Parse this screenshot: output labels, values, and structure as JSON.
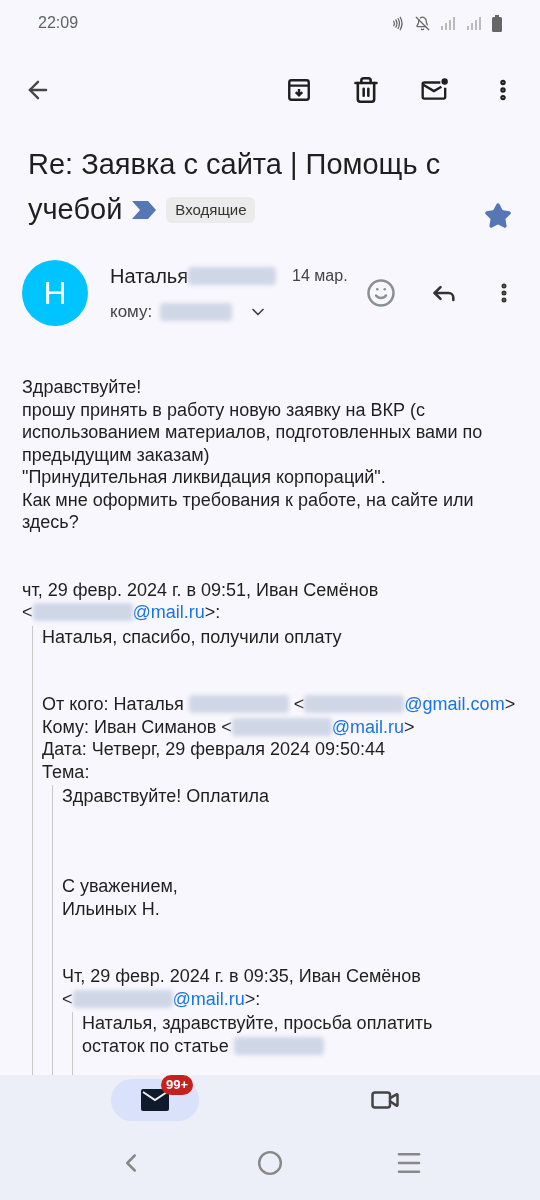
{
  "status_bar": {
    "time": "22:09"
  },
  "subject": {
    "lines": [
      "Re: Заявка с сайта | Помощь с",
      "учебой"
    ],
    "important": true,
    "label": "Входящие",
    "starred": true
  },
  "sender": {
    "avatar_letter": "Н",
    "name": [
      {
        "kind": "text",
        "text": "Наталья"
      },
      {
        "kind": "redacted"
      }
    ],
    "date": "14 мар.",
    "to_label": "кому:"
  },
  "body": [
    {
      "kind": "line",
      "segments": [
        {
          "kind": "text",
          "text": "Здравствуйте!"
        }
      ]
    },
    {
      "kind": "line",
      "segments": [
        {
          "kind": "text",
          "text": "прошу принять в работу новую заявку на ВКР (с"
        }
      ]
    },
    {
      "kind": "line",
      "segments": [
        {
          "kind": "text",
          "text": "использованием материалов, подготовленных вами по"
        }
      ]
    },
    {
      "kind": "line",
      "segments": [
        {
          "kind": "text",
          "text": "предыдущим заказам)"
        }
      ]
    },
    {
      "kind": "line",
      "segments": [
        {
          "kind": "text",
          "text": "\"Принудительная ликвидация корпораций\"."
        }
      ]
    },
    {
      "kind": "line",
      "segments": [
        {
          "kind": "text",
          "text": "Как мне оформить требования к работе, на сайте или"
        }
      ]
    },
    {
      "kind": "line",
      "segments": [
        {
          "kind": "text",
          "text": "здесь?"
        }
      ]
    },
    {
      "kind": "blank"
    },
    {
      "kind": "blank"
    },
    {
      "kind": "line",
      "segments": [
        {
          "kind": "text",
          "text": "чт, 29 февр. 2024 г. в 09:51, Иван Семёнов"
        }
      ]
    },
    {
      "kind": "line",
      "segments": [
        {
          "kind": "text",
          "text": "<"
        },
        {
          "kind": "redacted"
        },
        {
          "kind": "link",
          "text": "@mail.ru"
        },
        {
          "kind": "text",
          "text": ">:"
        }
      ]
    },
    {
      "kind": "quote",
      "children": [
        {
          "kind": "line",
          "segments": [
            {
              "kind": "text",
              "text": "Наталья, спасибо, получили оплату"
            }
          ]
        },
        {
          "kind": "blank"
        },
        {
          "kind": "blank"
        },
        {
          "kind": "line",
          "segments": [
            {
              "kind": "text",
              "text": "От кого: Наталья "
            },
            {
              "kind": "redacted"
            },
            {
              "kind": "text",
              "text": " <"
            },
            {
              "kind": "redacted"
            },
            {
              "kind": "link",
              "text": "@gmail.com"
            },
            {
              "kind": "text",
              "text": ">"
            }
          ]
        },
        {
          "kind": "line",
          "segments": [
            {
              "kind": "text",
              "text": "Кому: Иван Симанов <"
            },
            {
              "kind": "redacted"
            },
            {
              "kind": "link",
              "text": "@mail.ru"
            },
            {
              "kind": "text",
              "text": ">"
            }
          ]
        },
        {
          "kind": "line",
          "segments": [
            {
              "kind": "text",
              "text": "Дата: Четверг, 29 февраля 2024 09:50:44"
            }
          ]
        },
        {
          "kind": "line",
          "segments": [
            {
              "kind": "text",
              "text": "Тема:"
            }
          ]
        },
        {
          "kind": "quote",
          "children": [
            {
              "kind": "line",
              "segments": [
                {
                  "kind": "text",
                  "text": "Здравствуйте! Оплатила"
                }
              ]
            },
            {
              "kind": "blank"
            },
            {
              "kind": "blank"
            },
            {
              "kind": "blank"
            },
            {
              "kind": "line",
              "segments": [
                {
                  "kind": "text",
                  "text": "С уважением,"
                }
              ]
            },
            {
              "kind": "line",
              "segments": [
                {
                  "kind": "text",
                  "text": "Ильиных Н."
                }
              ]
            },
            {
              "kind": "blank"
            },
            {
              "kind": "blank"
            },
            {
              "kind": "line",
              "segments": [
                {
                  "kind": "text",
                  "text": "Чт, 29 февр. 2024 г. в 09:35, Иван Семёнов"
                }
              ]
            },
            {
              "kind": "line",
              "segments": [
                {
                  "kind": "text",
                  "text": "<"
                },
                {
                  "kind": "redacted"
                },
                {
                  "kind": "link",
                  "text": "@mail.ru"
                },
                {
                  "kind": "text",
                  "text": ">:"
                }
              ]
            },
            {
              "kind": "quote",
              "children": [
                {
                  "kind": "line",
                  "segments": [
                    {
                      "kind": "text",
                      "text": "Наталья, здравствуйте, просьба оплатить"
                    }
                  ]
                },
                {
                  "kind": "line",
                  "segments": [
                    {
                      "kind": "text",
                      "text": "остаток по статье "
                    },
                    {
                      "kind": "redacted"
                    }
                  ]
                },
                {
                  "kind": "blank"
                },
                {
                  "kind": "blank"
                },
                {
                  "kind": "blank"
                }
              ]
            }
          ]
        }
      ]
    }
  ],
  "bottom_nav": [
    {
      "kind": "mail",
      "selected": true,
      "badge": "99+"
    },
    {
      "kind": "video",
      "selected": false
    }
  ]
}
